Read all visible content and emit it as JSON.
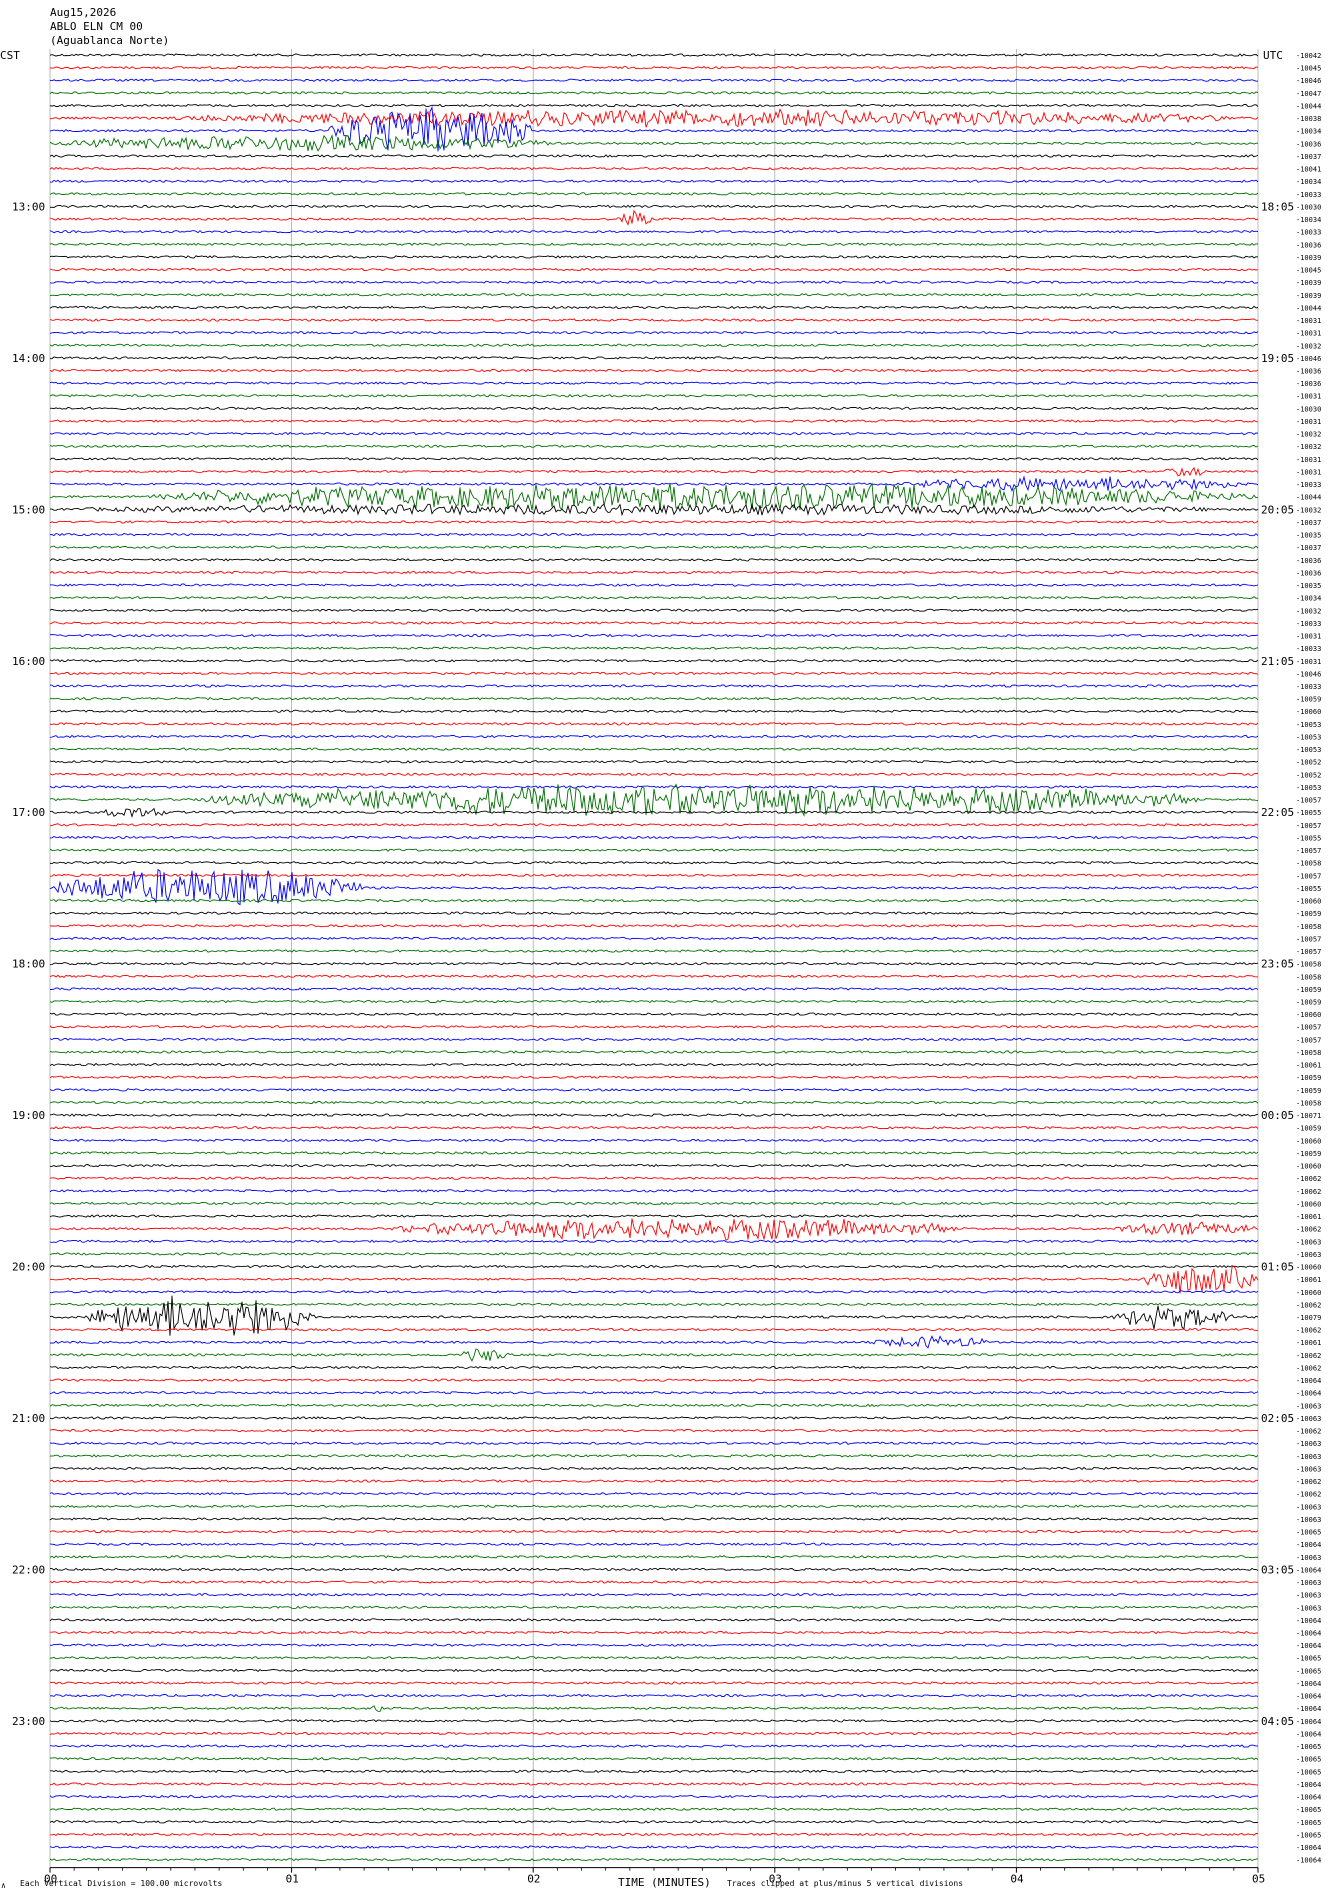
{
  "header": {
    "date": "Aug15,2026",
    "station": "ABLO ELN CM 00",
    "location": "(Aguablanca Norte)",
    "left_zone": "CST",
    "right_zone": "UTC"
  },
  "footer": {
    "scale_note": "Each Vertical Division =  100.00 microvolts",
    "time_label": "TIME (MINUTES)",
    "clip_note": "Traces clipped at plus/minus 5 vertical divisions",
    "corner_mark": "∧"
  },
  "chart_data": {
    "type": "helicorder",
    "xlim": [
      0,
      5
    ],
    "x_ticks": [
      "00",
      "01",
      "02",
      "03",
      "04",
      "05"
    ],
    "trace_colors": [
      "#000000",
      "#ff0000",
      "#0000ff",
      "#007000"
    ],
    "hour_labels_left": [
      "13:00",
      "14:00",
      "15:00",
      "16:00",
      "17:00",
      "18:00",
      "19:00",
      "20:00",
      "21:00",
      "22:00",
      "23:00"
    ],
    "hour_labels_right": [
      "18:05",
      "19:05",
      "20:05",
      "21:05",
      "22:05",
      "23:05",
      "00:05",
      "01:05",
      "02:05",
      "03:05",
      "04:05"
    ],
    "hour_row_index": [
      12,
      24,
      36,
      48,
      60,
      72,
      84,
      96,
      108,
      120,
      132
    ],
    "offsets": [
      "-10042",
      "-10045",
      "-10046",
      "-10047",
      "-10044",
      "-10038",
      "-10034",
      "-10036",
      "-10037",
      "-10041",
      "-10034",
      "-10033",
      "-10030",
      "-10034",
      "-10033",
      "-10036",
      "-10039",
      "-10045",
      "-10039",
      "-10039",
      "-10044",
      "-10031",
      "-10031",
      "-10032",
      "-10046",
      "-10036",
      "-10036",
      "-10031",
      "-10030",
      "-10031",
      "-10032",
      "-10032",
      "-10031",
      "-10031",
      "-10033",
      "-10044",
      "-10032",
      "-10037",
      "-10035",
      "-10037",
      "-10036",
      "-10036",
      "-10035",
      "-10034",
      "-10032",
      "-10033",
      "-10031",
      "-10033",
      "-10031",
      "-10046",
      "-10033",
      "-10059",
      "-10060",
      "-10053",
      "-10053",
      "-10053",
      "-10052",
      "-10052",
      "-10053",
      "-10057",
      "-10055",
      "-10057",
      "-10055",
      "-10057",
      "-10058",
      "-10057",
      "-10055",
      "-10060",
      "-10059",
      "-10058",
      "-10057",
      "-10057",
      "-10058",
      "-10058",
      "-10059",
      "-10059",
      "-10060",
      "-10057",
      "-10057",
      "-10058",
      "-10061",
      "-10059",
      "-10059",
      "-10058",
      "-10071",
      "-10059",
      "-10060",
      "-10059",
      "-10060",
      "-10062",
      "-10062",
      "-10060",
      "-10061",
      "-10062",
      "-10063",
      "-10063",
      "-10060",
      "-10061",
      "-10060",
      "-10062",
      "-10079",
      "-10062",
      "-10061",
      "-10062",
      "-10062",
      "-10064",
      "-10064",
      "-10063",
      "-10063",
      "-10062",
      "-10063",
      "-10063",
      "-10063",
      "-10062",
      "-10062",
      "-10063",
      "-10063",
      "-10065",
      "-10064",
      "-10063",
      "-10064",
      "-10063",
      "-10063",
      "-10063",
      "-10064",
      "-10064",
      "-10064",
      "-10065",
      "-10065",
      "-10064",
      "-10064",
      "-10064",
      "-10064",
      "-10064",
      "-10065",
      "-10065",
      "-10065",
      "-10064",
      "-10064",
      "-10065",
      "-10065",
      "-10065",
      "-10064",
      "-10064"
    ],
    "events": [
      {
        "row": 5,
        "start": 0.45,
        "end": 5.0,
        "amp": 1.4
      },
      {
        "row": 6,
        "start": 1.15,
        "end": 2.0,
        "amp": 4.0
      },
      {
        "row": 7,
        "start": 0.0,
        "end": 2.1,
        "amp": 1.3
      },
      {
        "row": 13,
        "start": 2.35,
        "end": 2.5,
        "amp": 1.5
      },
      {
        "row": 33,
        "start": 4.6,
        "end": 4.8,
        "amp": 0.9
      },
      {
        "row": 34,
        "start": 3.5,
        "end": 5.0,
        "amp": 1.2
      },
      {
        "row": 35,
        "start": 0.4,
        "end": 5.0,
        "amp": 2.2
      },
      {
        "row": 36,
        "start": 0.0,
        "end": 5.0,
        "amp": 0.9
      },
      {
        "row": 59,
        "start": 0.6,
        "end": 4.8,
        "amp": 2.6
      },
      {
        "row": 60,
        "start": 0.2,
        "end": 0.5,
        "amp": 0.9
      },
      {
        "row": 66,
        "start": 0.0,
        "end": 1.3,
        "amp": 3.2
      },
      {
        "row": 93,
        "start": 1.4,
        "end": 3.8,
        "amp": 1.8
      },
      {
        "row": 93,
        "start": 4.4,
        "end": 5.0,
        "amp": 1.2
      },
      {
        "row": 97,
        "start": 4.5,
        "end": 5.0,
        "amp": 2.5
      },
      {
        "row": 100,
        "start": 0.15,
        "end": 1.1,
        "amp": 3.5
      },
      {
        "row": 100,
        "start": 4.4,
        "end": 4.9,
        "amp": 2.0
      },
      {
        "row": 102,
        "start": 3.4,
        "end": 3.9,
        "amp": 1.0
      },
      {
        "row": 103,
        "start": 1.7,
        "end": 1.9,
        "amp": 1.2
      },
      {
        "row": 131,
        "start": 1.32,
        "end": 1.38,
        "amp": 0.9
      }
    ]
  }
}
